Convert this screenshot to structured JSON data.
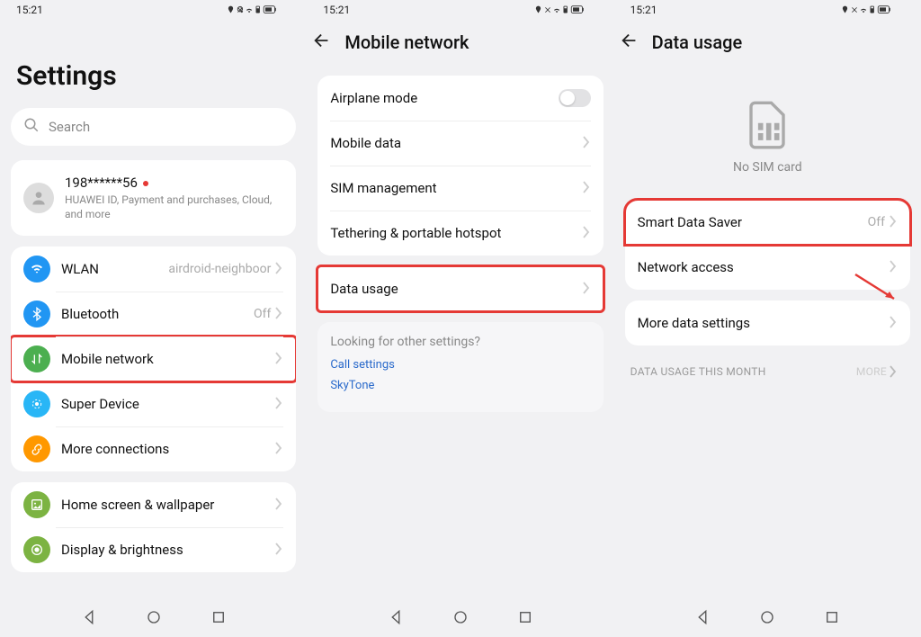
{
  "status": {
    "time": "15:21",
    "icons": "📍🔕📶🔋⬚"
  },
  "p1": {
    "title": "Settings",
    "search_placeholder": "Search",
    "account": {
      "name": "198******56",
      "sub": "HUAWEI ID, Payment and purchases, Cloud, and more"
    },
    "items": [
      {
        "label": "WLAN",
        "value": "airdroid-neighboor"
      },
      {
        "label": "Bluetooth",
        "value": "Off"
      },
      {
        "label": "Mobile network",
        "value": "",
        "hl": true
      },
      {
        "label": "Super Device",
        "value": ""
      },
      {
        "label": "More connections",
        "value": ""
      }
    ],
    "items2": [
      {
        "label": "Home screen & wallpaper"
      },
      {
        "label": "Display & brightness"
      }
    ]
  },
  "p2": {
    "title": "Mobile network",
    "rows": [
      {
        "label": "Airplane mode",
        "toggle": true
      },
      {
        "label": "Mobile data"
      },
      {
        "label": "SIM management"
      },
      {
        "label": "Tethering & portable hotspot"
      }
    ],
    "data_usage": "Data usage",
    "other": {
      "title": "Looking for other settings?",
      "links": [
        "Call settings",
        "SkyTone"
      ]
    }
  },
  "p3": {
    "title": "Data usage",
    "no_sim": "No SIM card",
    "rows": [
      {
        "label": "Smart Data Saver",
        "value": "Off",
        "hl": true
      },
      {
        "label": "Network access"
      }
    ],
    "more": "More data settings",
    "section": "DATA USAGE THIS MONTH",
    "section_more": "MORE"
  }
}
